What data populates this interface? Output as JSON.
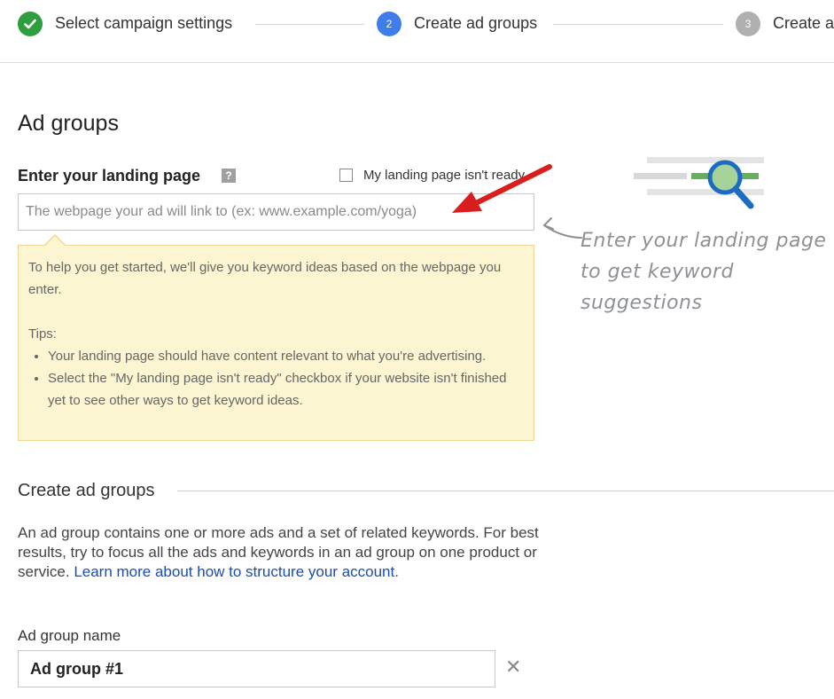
{
  "steps": [
    {
      "label": "Select campaign settings",
      "status": "complete",
      "number": ""
    },
    {
      "label": "Create ad groups",
      "status": "current",
      "number": "2"
    },
    {
      "label": "Create a",
      "status": "upcoming",
      "number": "3"
    }
  ],
  "colors": {
    "complete": "#2e9e3f",
    "current": "#3f7ee8",
    "upcoming": "#b0b0b0",
    "link": "#1a4db3",
    "tip_bg": "#fcf5d2",
    "arrow": "#d81e1e"
  },
  "page_title": "Ad groups",
  "landing": {
    "label": "Enter your landing page",
    "help_icon": "?",
    "not_ready_label": "My landing page isn't ready",
    "placeholder": "The webpage your ad will link to (ex: www.example.com/yoga)"
  },
  "tip": {
    "intro": "To help you get started, we'll give you keyword ideas based on the webpage you enter.",
    "tips_heading": "Tips:",
    "items": [
      "Your landing page should have content relevant to what you're advertising.",
      "Select the \"My landing page isn't ready\" checkbox if your website isn't finished yet to see other ways to get keyword ideas."
    ]
  },
  "illustration": {
    "icon": "magnifier-keywords-icon",
    "hint": "Enter your landing page to get keyword suggestions"
  },
  "create_section": {
    "title": "Create ad groups",
    "description": "An ad group contains one or more ads and a set of related keywords. For best results, try to focus all the ads and keywords in an ad group on one product or service.",
    "link_text": "Learn more about how to structure your account."
  },
  "ad_group": {
    "name_label": "Ad group name",
    "name_value": "Ad group #1",
    "remove_icon": "✕"
  }
}
